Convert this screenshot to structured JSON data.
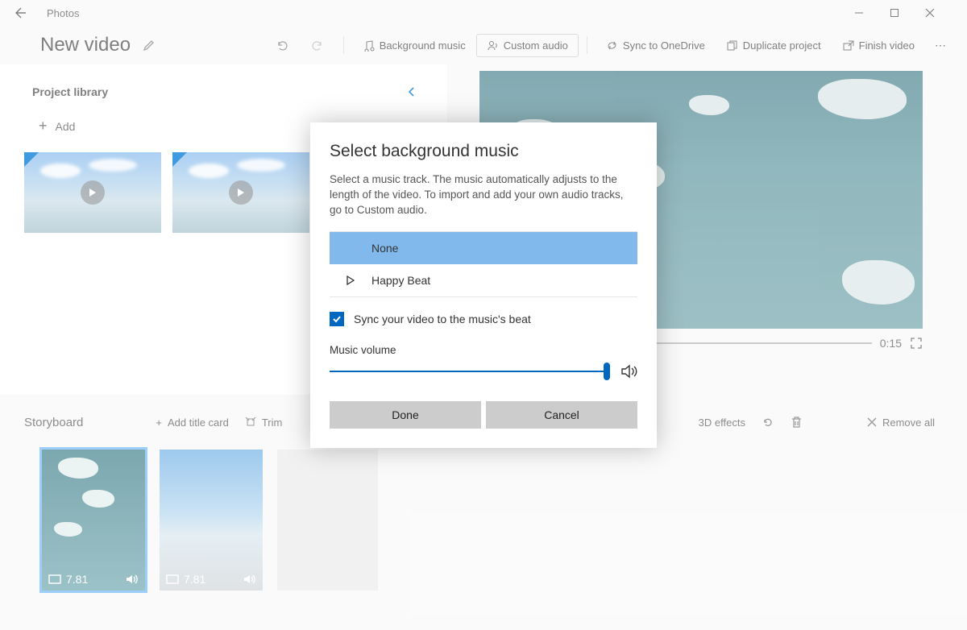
{
  "app": {
    "name": "Photos",
    "title": "New video"
  },
  "toolbar": {
    "bg_music": "Background music",
    "custom_audio": "Custom audio",
    "sync": "Sync to OneDrive",
    "duplicate": "Duplicate project",
    "finish": "Finish video"
  },
  "library": {
    "title": "Project library",
    "add": "Add"
  },
  "preview": {
    "duration": "0:15"
  },
  "storyboard": {
    "title": "Storyboard",
    "add_title": "Add title card",
    "trim": "Trim",
    "effects": "3D effects",
    "remove": "Remove all",
    "clips": [
      {
        "duration": "7.81"
      },
      {
        "duration": "7.81"
      }
    ]
  },
  "modal": {
    "title": "Select background music",
    "desc": "Select a music track. The music automatically adjusts to the length of the video. To import and add your own audio tracks, go to Custom audio.",
    "tracks": {
      "none": "None",
      "happy": "Happy Beat"
    },
    "sync_label": "Sync your video to the music's beat",
    "volume_label": "Music volume",
    "done": "Done",
    "cancel": "Cancel"
  }
}
